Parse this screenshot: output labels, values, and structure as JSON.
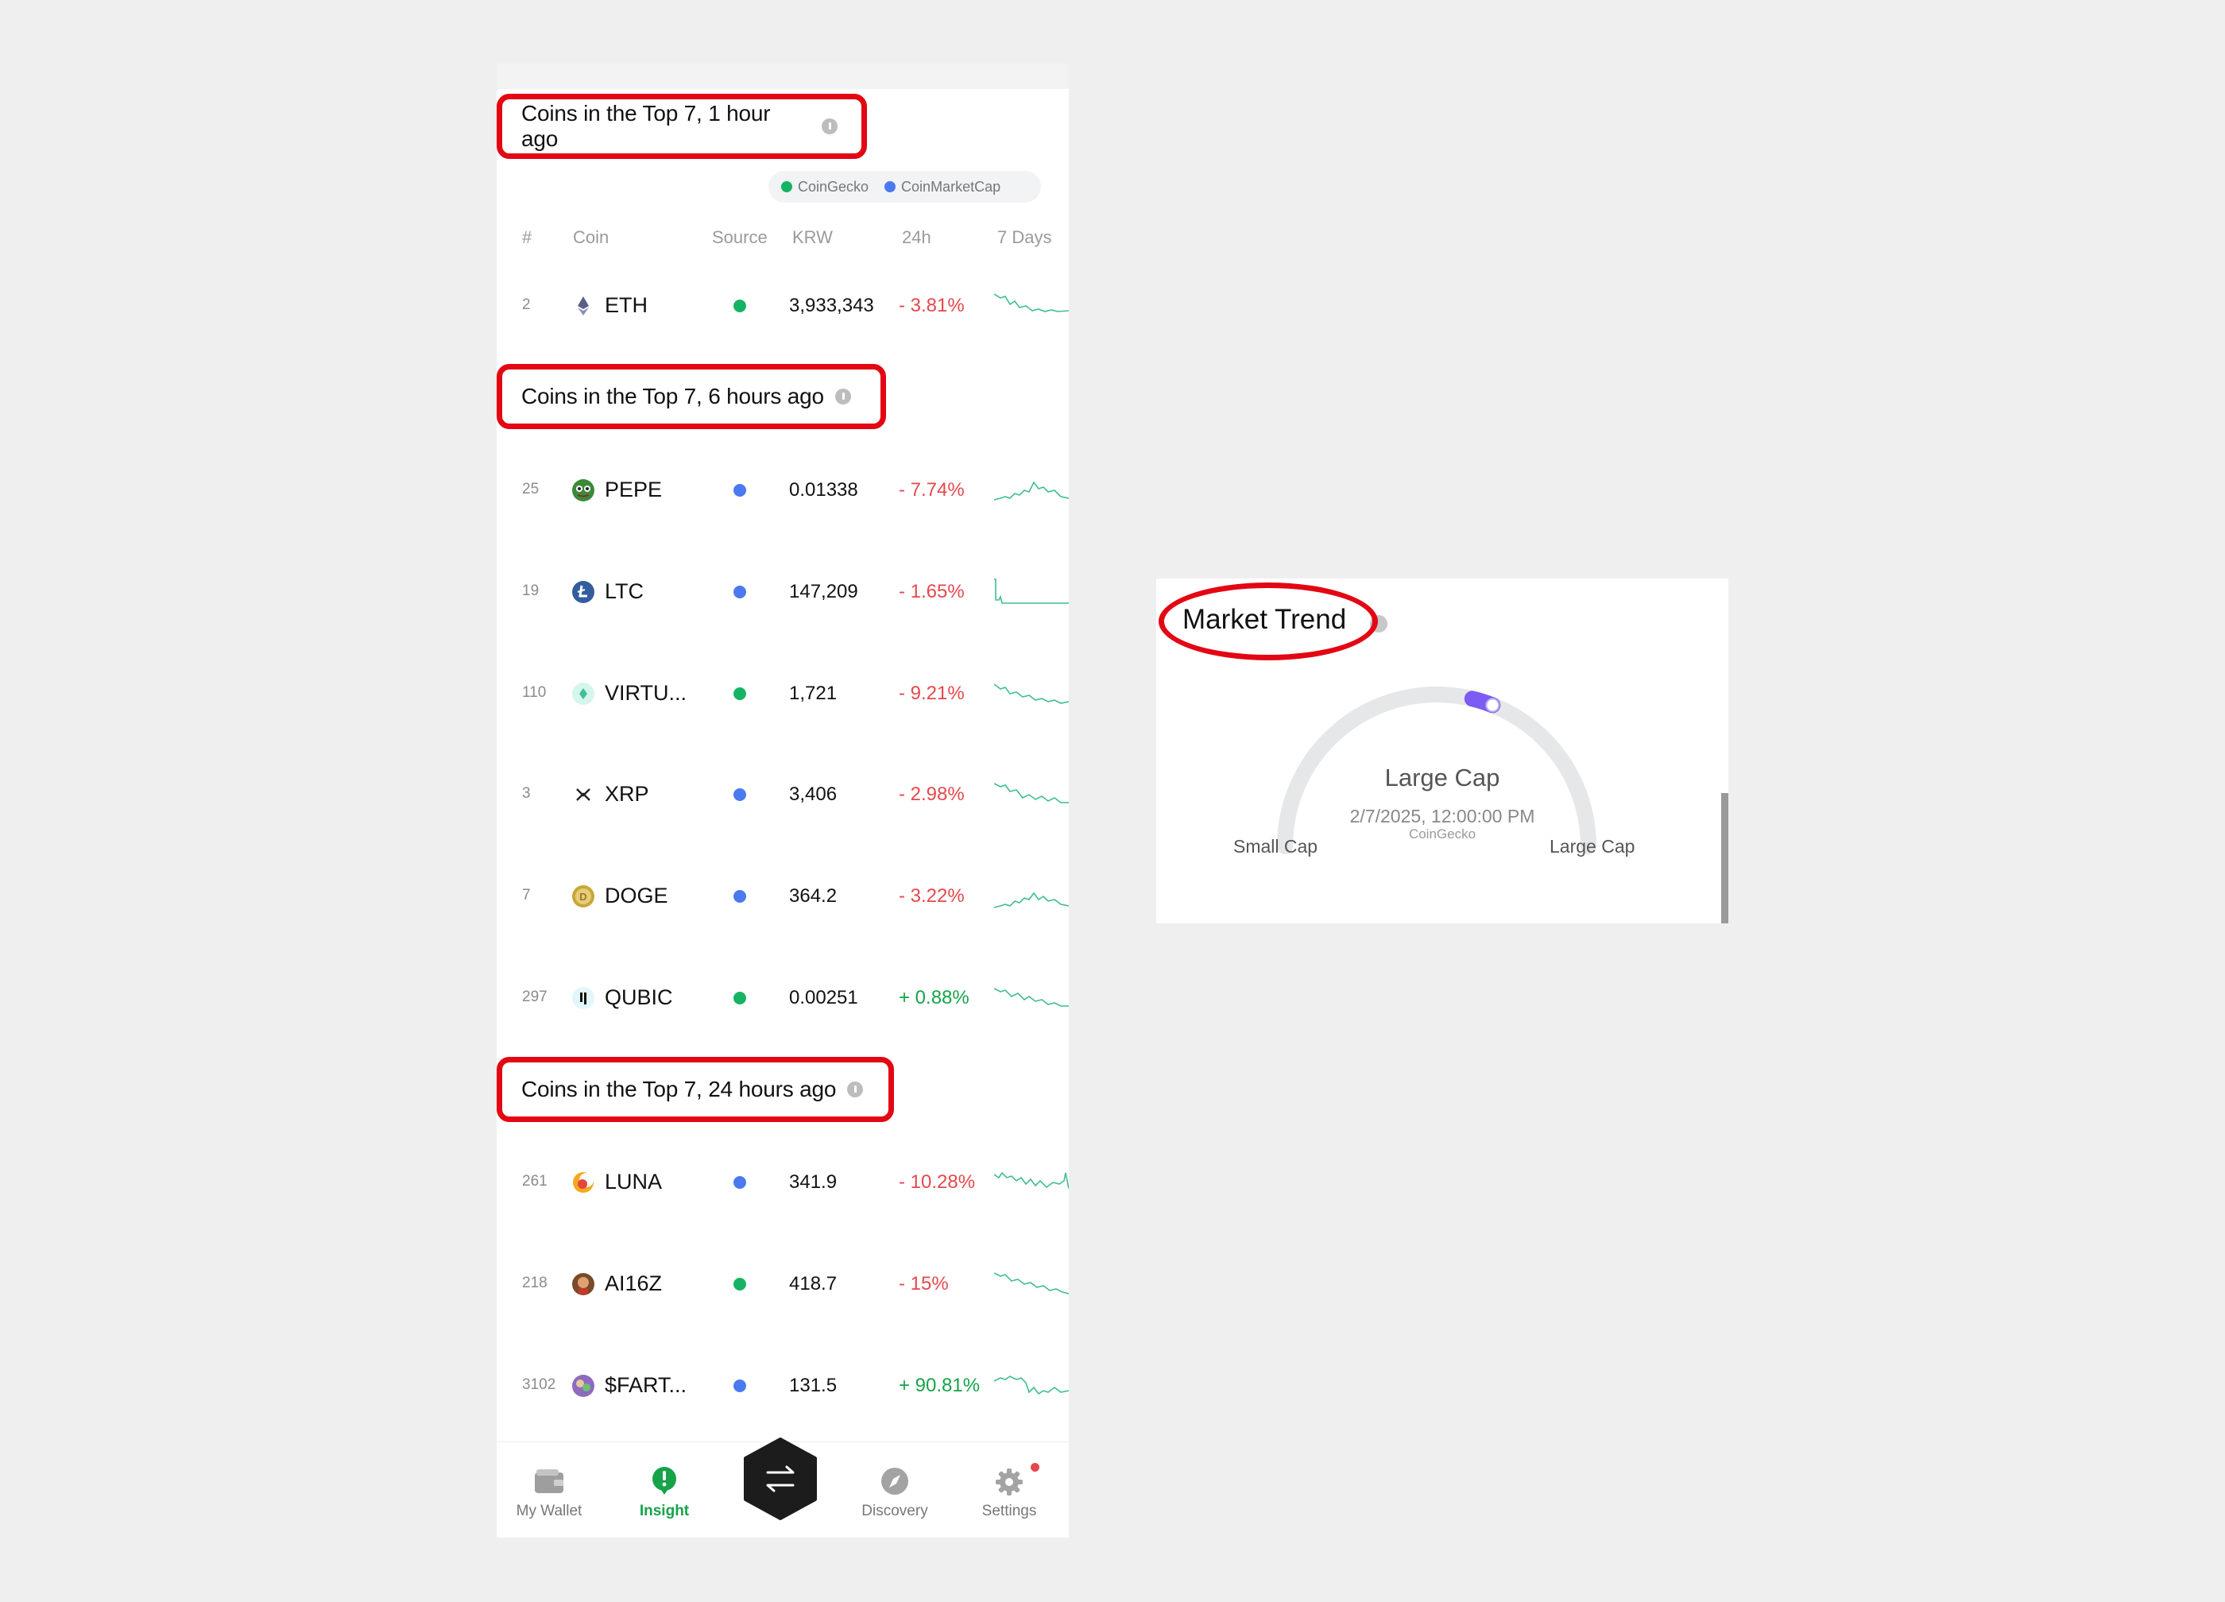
{
  "sections": [
    {
      "title": "Coins in the Top 7, 1 hour ago"
    },
    {
      "title": "Coins in the Top 7, 6 hours ago"
    },
    {
      "title": "Coins in the Top 7, 24 hours ago"
    }
  ],
  "legend": {
    "coingecko": "CoinGecko",
    "coinmarketcap": "CoinMarketCap"
  },
  "colors": {
    "coingecko": "#16b364",
    "coinmarketcap": "#4a79f0",
    "negative": "#e5484d",
    "positive": "#16a34a",
    "highlight": "#e30613",
    "gauge_accent": "#7c5cf2"
  },
  "headers": {
    "rank": "#",
    "coin": "Coin",
    "source": "Source",
    "price": "KRW",
    "change": "24h",
    "spark": "7 Days"
  },
  "rows": [
    {
      "rank": "2",
      "coin": "ETH",
      "source": "coingecko",
      "price": "3,933,343",
      "change": "- 3.81%",
      "icon": "eth-icon"
    },
    {
      "rank": "25",
      "coin": "PEPE",
      "source": "coinmarketcap",
      "price": "0.01338",
      "change": "- 7.74%",
      "icon": "pepe-icon"
    },
    {
      "rank": "19",
      "coin": "LTC",
      "source": "coinmarketcap",
      "price": "147,209",
      "change": "- 1.65%",
      "icon": "ltc-icon"
    },
    {
      "rank": "110",
      "coin": "VIRTU...",
      "source": "coingecko",
      "price": "1,721",
      "change": "- 9.21%",
      "icon": "virtuals-icon"
    },
    {
      "rank": "3",
      "coin": "XRP",
      "source": "coinmarketcap",
      "price": "3,406",
      "change": "- 2.98%",
      "icon": "xrp-icon"
    },
    {
      "rank": "7",
      "coin": "DOGE",
      "source": "coinmarketcap",
      "price": "364.2",
      "change": "- 3.22%",
      "icon": "doge-icon"
    },
    {
      "rank": "297",
      "coin": "QUBIC",
      "source": "coingecko",
      "price": "0.00251",
      "change": "+ 0.88%",
      "icon": "qubic-icon"
    },
    {
      "rank": "261",
      "coin": "LUNA",
      "source": "coinmarketcap",
      "price": "341.9",
      "change": "- 10.28%",
      "icon": "luna-icon"
    },
    {
      "rank": "218",
      "coin": "AI16Z",
      "source": "coingecko",
      "price": "418.7",
      "change": "- 15%",
      "icon": "ai16z-icon"
    },
    {
      "rank": "3102",
      "coin": "$FART...",
      "source": "coinmarketcap",
      "price": "131.5",
      "change": "+ 90.81%",
      "icon": "fartcoin-icon"
    }
  ],
  "nav": [
    {
      "label": "My Wallet",
      "icon": "wallet-icon"
    },
    {
      "label": "Insight",
      "icon": "insight-icon"
    },
    {
      "label": "",
      "icon": "swap-icon"
    },
    {
      "label": "Discovery",
      "icon": "compass-icon"
    },
    {
      "label": "Settings",
      "icon": "gear-icon"
    }
  ],
  "market_trend": {
    "title": "Market Trend",
    "value": "Large Cap",
    "timestamp": "2/7/2025, 12:00:00 PM",
    "source": "CoinGecko",
    "left_label": "Small Cap",
    "right_label": "Large Cap",
    "gauge_position": 0.62
  }
}
